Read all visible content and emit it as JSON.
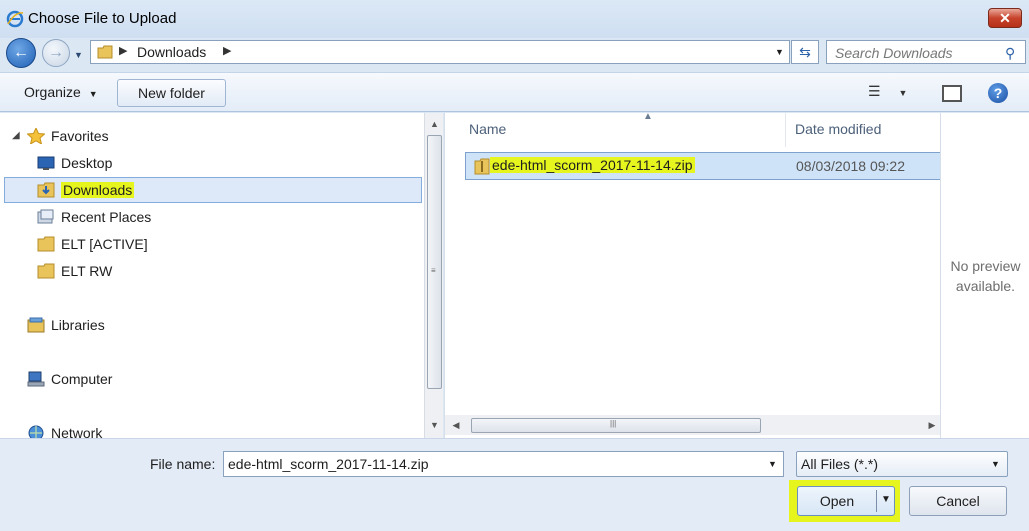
{
  "window": {
    "title": "Choose File to Upload",
    "close_label": "✕"
  },
  "address_bar": {
    "crumbs": [
      "Downloads"
    ],
    "search_placeholder": "Search Downloads"
  },
  "toolbar": {
    "organize_label": "Organize",
    "new_folder_label": "New folder"
  },
  "nav": {
    "favorites": {
      "label": "Favorites",
      "items": [
        {
          "label": "Desktop",
          "icon": "desktop-icon"
        },
        {
          "label": "Downloads",
          "icon": "downloads-folder-icon",
          "selected": true
        },
        {
          "label": "Recent Places",
          "icon": "recent-places-icon"
        },
        {
          "label": "ELT [ACTIVE]",
          "icon": "folder-icon"
        },
        {
          "label": "ELT RW",
          "icon": "folder-icon"
        }
      ]
    },
    "libraries_label": "Libraries",
    "computer_label": "Computer",
    "network_label": "Network"
  },
  "file_list": {
    "columns": {
      "name": "Name",
      "date_modified": "Date modified"
    },
    "rows": [
      {
        "name": "ede-html_scorm_2017-11-14.zip",
        "date_modified": "08/03/2018 09:22",
        "selected": true
      }
    ]
  },
  "preview": {
    "line1": "No preview",
    "line2": "available."
  },
  "footer": {
    "file_name_label": "File name:",
    "file_name_value": "ede-html_scorm_2017-11-14.zip",
    "filter_value": "All Files (*.*)",
    "open_label": "Open",
    "cancel_label": "Cancel"
  },
  "colors": {
    "highlight": "#e6f51e",
    "selection": "#cfe3f8",
    "accent": "#1f5fb5"
  }
}
